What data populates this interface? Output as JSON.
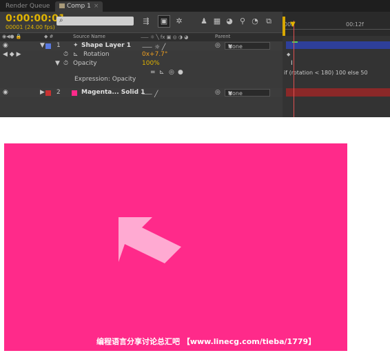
{
  "tabs": {
    "render_queue": "Render Queue",
    "comp": "Comp 1",
    "close_glyph": "×"
  },
  "timecode": {
    "main": "0:00:00:01",
    "frames": "00001 (24.00 fps)"
  },
  "search": {
    "placeholder": "",
    "icon": "search-icon"
  },
  "ruler": {
    "start": "00f",
    "mark": "00:12f"
  },
  "columns": {
    "source_name": "Source Name",
    "parent": "Parent"
  },
  "layers": [
    {
      "index": "1",
      "name": "Shape Layer 1",
      "parent": "None",
      "color": "#5a7ae0",
      "props": {
        "rotation_label": "Rotation",
        "rotation_value": "0x+7.7°",
        "opacity_label": "Opacity",
        "opacity_value": "100%",
        "expression_label": "Expression: Opacity",
        "expression_text": "if (rotation < 180) 100 else 50"
      }
    },
    {
      "index": "2",
      "name": "Magenta... Solid 1",
      "parent": "None",
      "color": "#c83232"
    }
  ],
  "comp_view": {
    "background": "#ff2a8a",
    "arrow_color": "#ffaad2"
  },
  "watermark": "编程语言分享讨论总汇吧 【www.linecg.com/tieba/1779】"
}
